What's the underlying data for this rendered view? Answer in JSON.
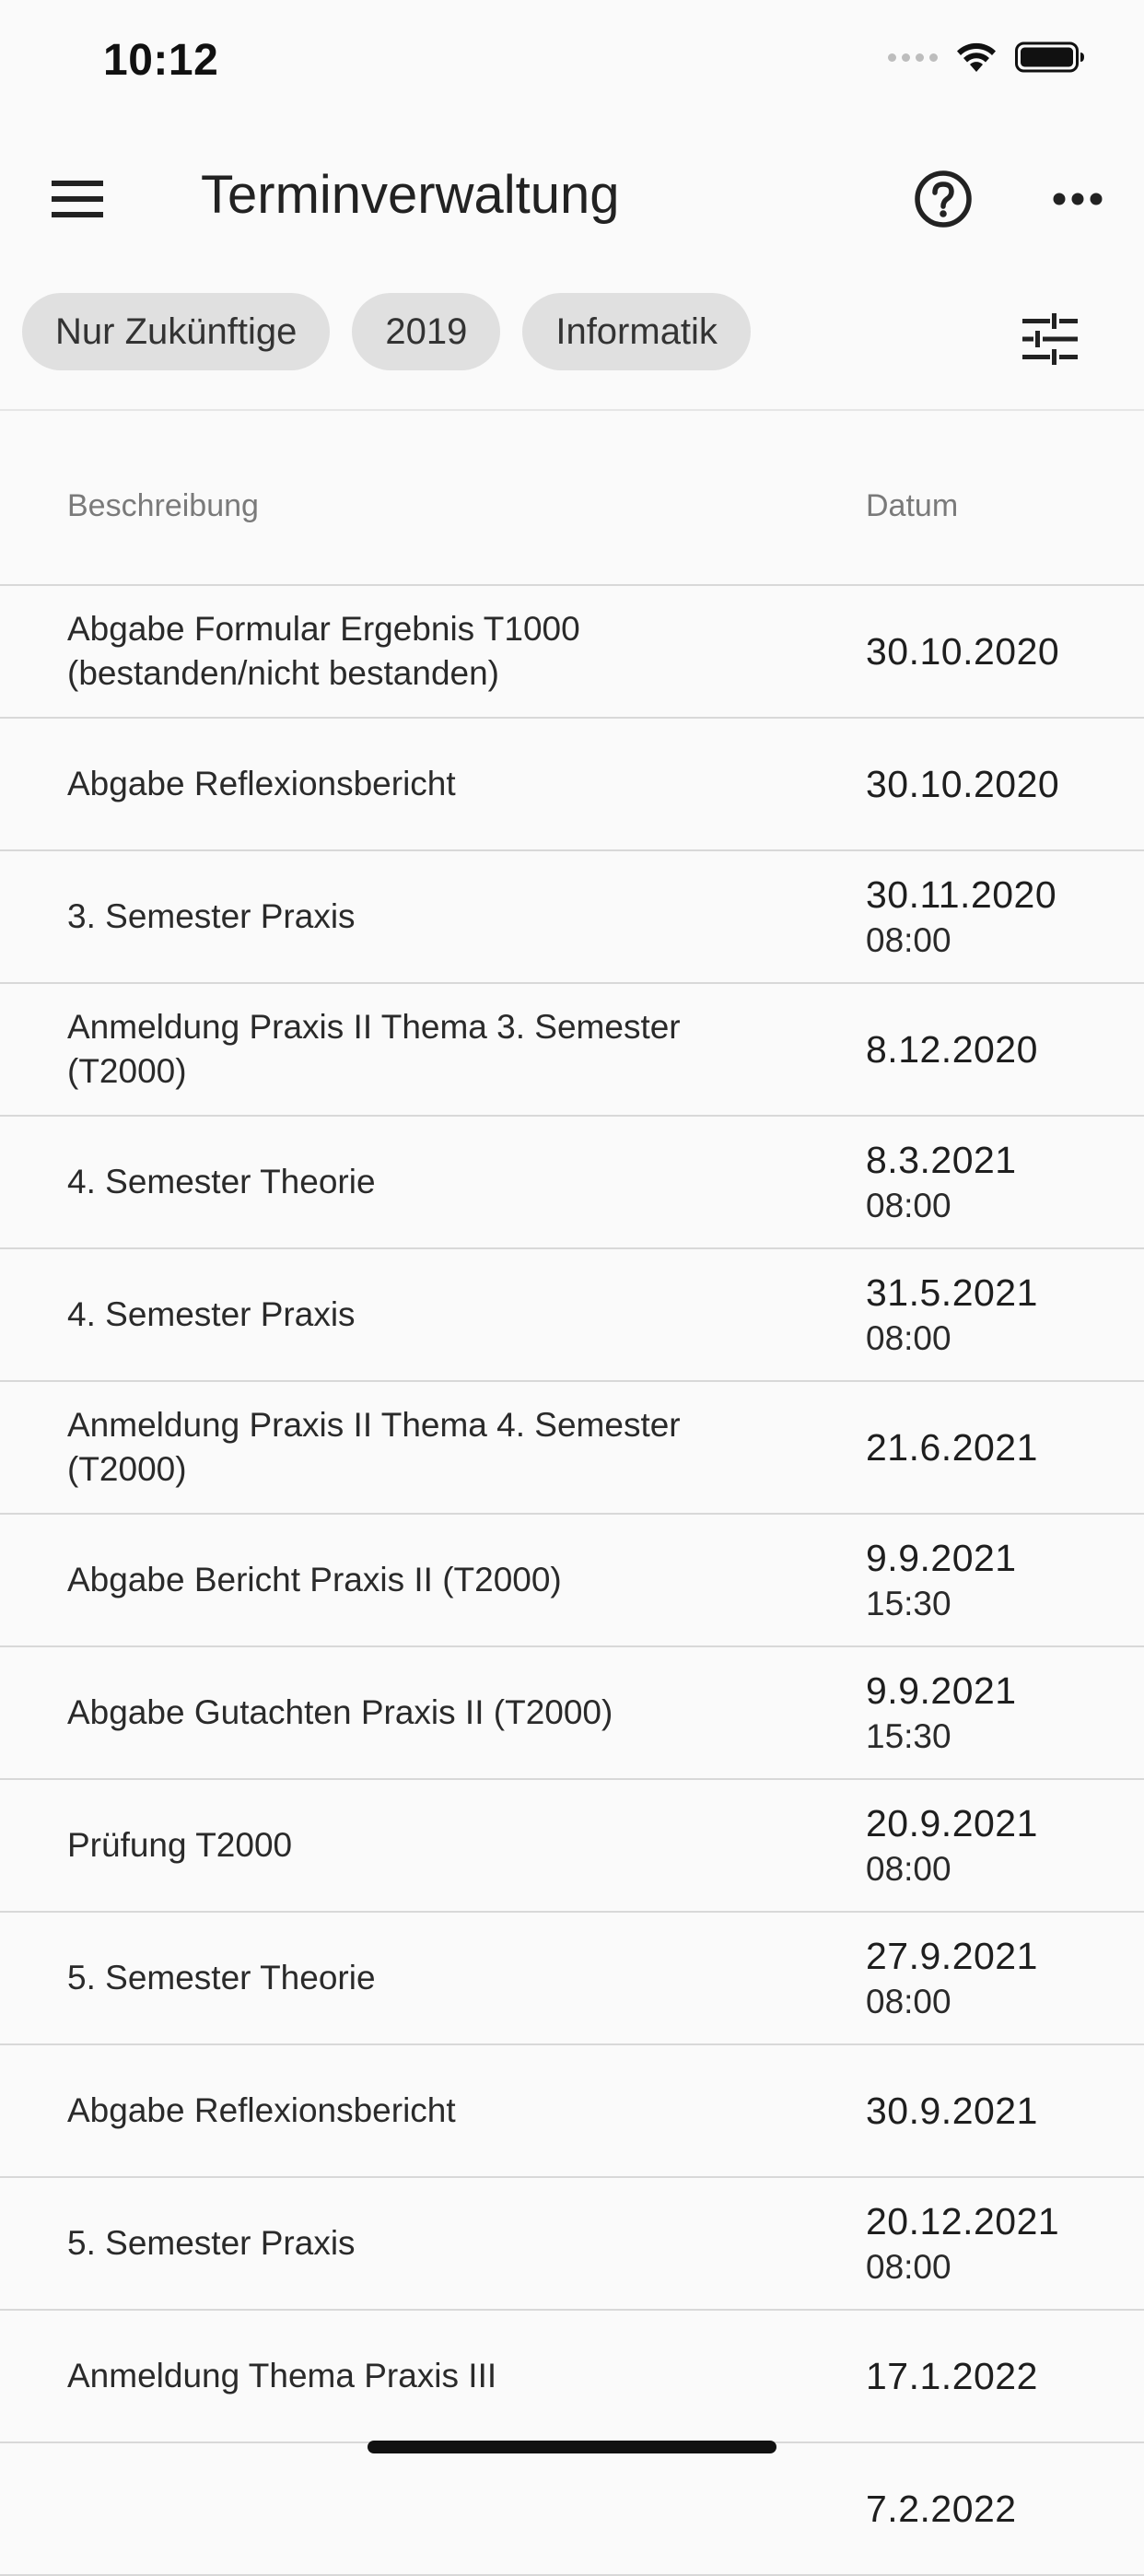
{
  "status_bar": {
    "time": "10:12"
  },
  "app_bar": {
    "title": "Terminverwaltung",
    "menu_icon": "menu-icon",
    "help_icon": "help-circle-icon",
    "more_icon": "more-horizontal-icon"
  },
  "filters": {
    "chips": [
      "Nur Zukünftige",
      "2019",
      "Informatik"
    ],
    "tune_icon": "tune-icon"
  },
  "table": {
    "headers": {
      "description": "Beschreibung",
      "date": "Datum"
    },
    "rows": [
      {
        "description": "Abgabe Formular Ergebnis T1000 (bestanden/nicht bestanden)",
        "date": "30.10.2020",
        "time": ""
      },
      {
        "description": "Abgabe Reflexionsbericht",
        "date": "30.10.2020",
        "time": ""
      },
      {
        "description": "3. Semester Praxis",
        "date": "30.11.2020",
        "time": "08:00"
      },
      {
        "description": "Anmeldung Praxis II Thema 3. Semester (T2000)",
        "date": "8.12.2020",
        "time": ""
      },
      {
        "description": "4. Semester Theorie",
        "date": "8.3.2021",
        "time": "08:00"
      },
      {
        "description": "4. Semester Praxis",
        "date": "31.5.2021",
        "time": "08:00"
      },
      {
        "description": "Anmeldung Praxis II Thema 4. Semester (T2000)",
        "date": "21.6.2021",
        "time": ""
      },
      {
        "description": "Abgabe Bericht Praxis II (T2000)",
        "date": "9.9.2021",
        "time": "15:30"
      },
      {
        "description": "Abgabe Gutachten Praxis II (T2000)",
        "date": "9.9.2021",
        "time": "15:30"
      },
      {
        "description": "Prüfung T2000",
        "date": "20.9.2021",
        "time": "08:00"
      },
      {
        "description": "5. Semester Theorie",
        "date": "27.9.2021",
        "time": "08:00"
      },
      {
        "description": "Abgabe Reflexionsbericht",
        "date": "30.9.2021",
        "time": ""
      },
      {
        "description": "5. Semester Praxis",
        "date": "20.12.2021",
        "time": "08:00"
      },
      {
        "description": "Anmeldung Thema Praxis III",
        "date": "17.1.2022",
        "time": ""
      },
      {
        "description": "",
        "date": "7.2.2022",
        "time": ""
      }
    ]
  },
  "colors": {
    "background": "#fafafa",
    "chip": "#e0e0e0",
    "divider": "#d8d8d8",
    "header_text": "#7a7a7a"
  }
}
